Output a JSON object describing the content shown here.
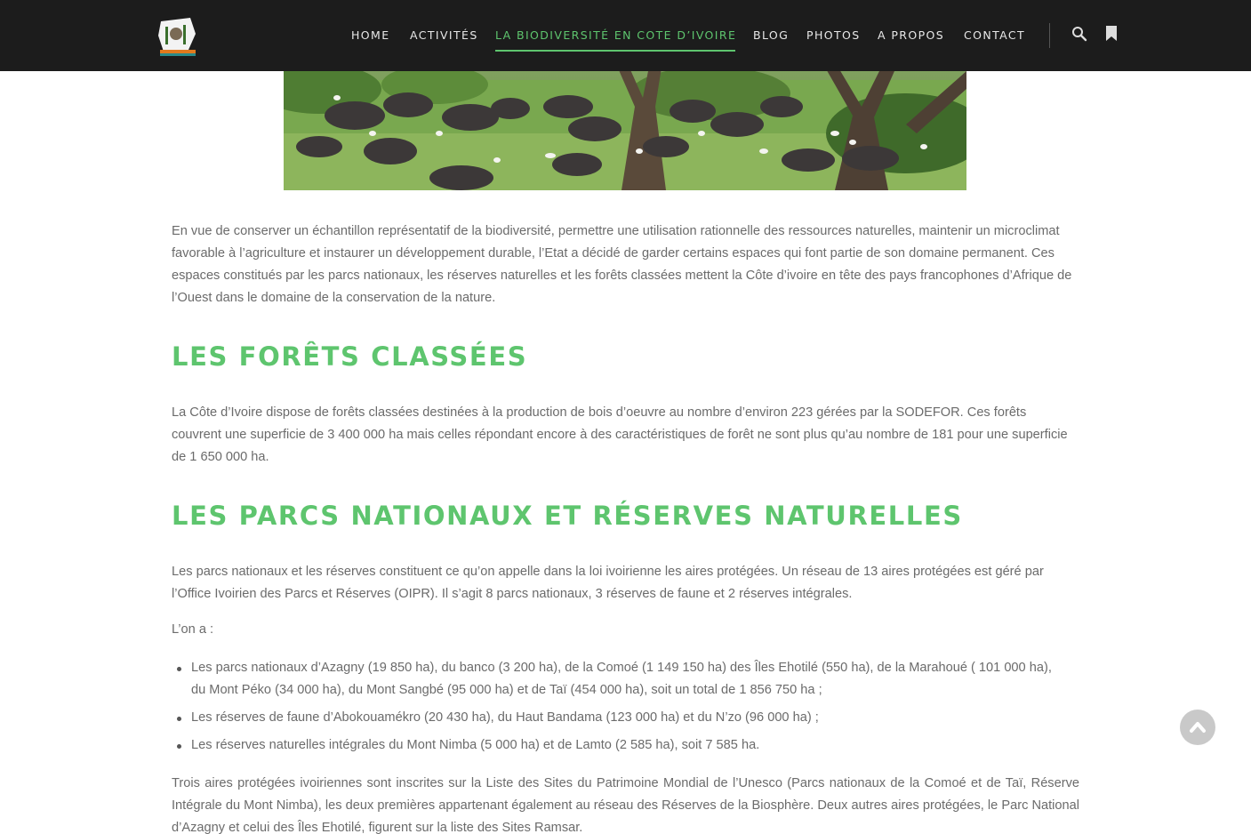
{
  "header": {
    "logo_alt": "logo",
    "nav": [
      {
        "label": "HOME"
      },
      {
        "label": "ACTIVITÉS"
      },
      {
        "label": "LA BIODIVERSITÉ EN COTE D’IVOIRE"
      },
      {
        "label": "BLOG"
      },
      {
        "label": "PHOTOS"
      },
      {
        "label": "A PROPOS"
      },
      {
        "label": "CONTACT"
      }
    ],
    "active_nav": "LA BIODIVERSITÉ EN COTE D’IVOIRE",
    "icons": [
      "search-icon",
      "bookmark-icon"
    ]
  },
  "hero": {
    "alt": "Buffles et aigrettes dans la savane"
  },
  "content": {
    "intro": "En vue de conserver un échantillon représentatif de la biodiversité, permettre une utilisation rationnelle des ressources naturelles, maintenir un microclimat favorable à l’agriculture et instaurer un développement durable, l’Etat a décidé de garder certains espaces qui font partie de son domaine permanent. Ces espaces constitués par les parcs nationaux, les réserves naturelles et les forêts classées mettent la Côte d’ivoire en tête des pays francophones d’Afrique de l’Ouest dans le domaine de la conservation de la nature.",
    "heading_forets": "LES FORÊTS CLASSÉES",
    "forets_text": "La Côte d’Ivoire dispose de forêts classées destinées à la production de bois d’oeuvre au nombre d’environ 223 gérées par la SODEFOR. Ces forêts couvrent une superficie de 3 400 000 ha mais celles répondant encore à des caractéristiques de forêt ne sont plus qu’au nombre de 181 pour une superficie de 1 650 000 ha.",
    "heading_parcs": "LES PARCS NATIONAUX ET RÉSERVES NATURELLES",
    "parcs_text": "Les parcs nationaux et les réserves constituent ce qu’on appelle dans la loi ivoirienne les aires protégées. Un réseau de 13 aires protégées est géré par l’Office Ivoirien des Parcs et Réserves (OIPR). Il s’agit 8 parcs nationaux, 3 réserves de faune et 2 réserves intégrales.",
    "on_a": "L’on a :",
    "list": [
      "Les parcs nationaux d’Azagny (19 850 ha), du banco (3 200 ha), de la Comoé (1 149 150 ha) des Îles Ehotilé (550 ha), de la Marahoué ( 101 000 ha), du Mont Péko (34 000 ha), du Mont Sangbé (95 000 ha) et de Taï (454 000 ha), soit un total de 1 856 750 ha ;",
      "Les réserves de faune d’Abokouamékro (20 430 ha), du Haut Bandama (123 000 ha) et du N’zo (96 000 ha) ;",
      "Les réserves naturelles intégrales du Mont Nimba (5 000 ha) et de Lamto (2 585 ha), soit 7 585 ha."
    ],
    "unesco_text": "Trois aires protégées ivoiriennes sont inscrites sur la Liste des Sites du Patrimoine Mondial de l’Unesco (Parcs nationaux de la Comoé et de Taï, Réserve Intégrale du Mont Nimba), les deux premières appartenant également au réseau des Réserves de la Biosphère. Deux autres aires protégées, le Parc National d’Azagny et celui des Îles Ehotilé, figurent sur la liste des Sites Ramsar."
  },
  "back_to_top": {
    "icon": "chevron-up-icon"
  },
  "colors": {
    "accent": "#5ec56e",
    "header_bg": "#1c1c1c",
    "text": "#6b6b6b"
  }
}
